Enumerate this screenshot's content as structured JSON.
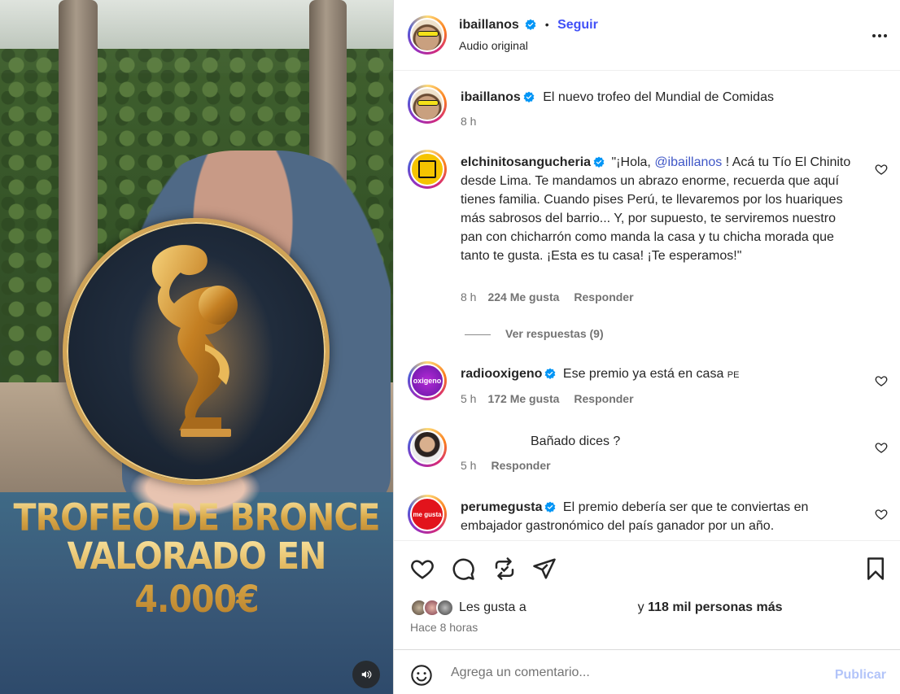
{
  "media": {
    "overlay_line1": "TROFEO DE BRONCE",
    "overlay_line2": "VALORADO EN 4.000€",
    "mute_icon": "speaker-icon"
  },
  "header": {
    "username": "ibaillanos",
    "separator": "•",
    "follow_label": "Seguir",
    "audio_label": "Audio original",
    "more_icon": "more-options-icon"
  },
  "caption": {
    "username": "ibaillanos",
    "text": "El nuevo trofeo del Mundial de Comidas",
    "time": "8 h"
  },
  "comments": [
    {
      "username": "elchinitosangucheria",
      "text_before": "\"¡Hola, ",
      "mention": "@ibaillanos",
      "text_after": " ! Acá tu Tío El Chinito desde Lima. Te mandamos un abrazo enorme, recuerda que aquí tienes familia. Cuando pises Perú, te llevaremos por los huariques más sabrosos del barrio... Y, por supuesto, te serviremos nuestro pan con chicharrón como manda la casa y tu chicha morada que tanto te gusta. ¡Esta es tu casa! ¡Te esperamos!\"",
      "time": "8 h",
      "likes": "224 Me gusta",
      "reply": "Responder",
      "view_replies": "Ver respuestas (9)"
    },
    {
      "username": "radiooxigeno",
      "avatar_text": "oxigeno",
      "text": "Ese premio ya está en casa ",
      "flag": "PE",
      "time": "5 h",
      "likes": "172 Me gusta",
      "reply": "Responder"
    },
    {
      "username": "",
      "text": "Bañado dices ?",
      "time": "5 h",
      "reply": "Responder"
    },
    {
      "username": "perumegusta",
      "avatar_text": "me gusta",
      "text": "El premio debería ser que te conviertas en embajador gastronómico del país ganador por un año."
    }
  ],
  "actions": {
    "like_icon": "heart-icon",
    "comment_icon": "comment-icon",
    "repost_icon": "repost-icon",
    "share_icon": "send-icon",
    "save_icon": "bookmark-icon"
  },
  "likes": {
    "prefix": "Les gusta a ",
    "conjunction": " y ",
    "count_text": "118 mil personas más",
    "time_ago": "Hace 8 horas"
  },
  "composer": {
    "placeholder": "Agrega un comentario...",
    "publish_label": "Publicar",
    "emoji_icon": "emoji-icon"
  },
  "colors": {
    "link": "#4150f7",
    "mention": "#3f56c6",
    "publish_disabled": "#b2c4f9",
    "verified": "#0095f6"
  }
}
